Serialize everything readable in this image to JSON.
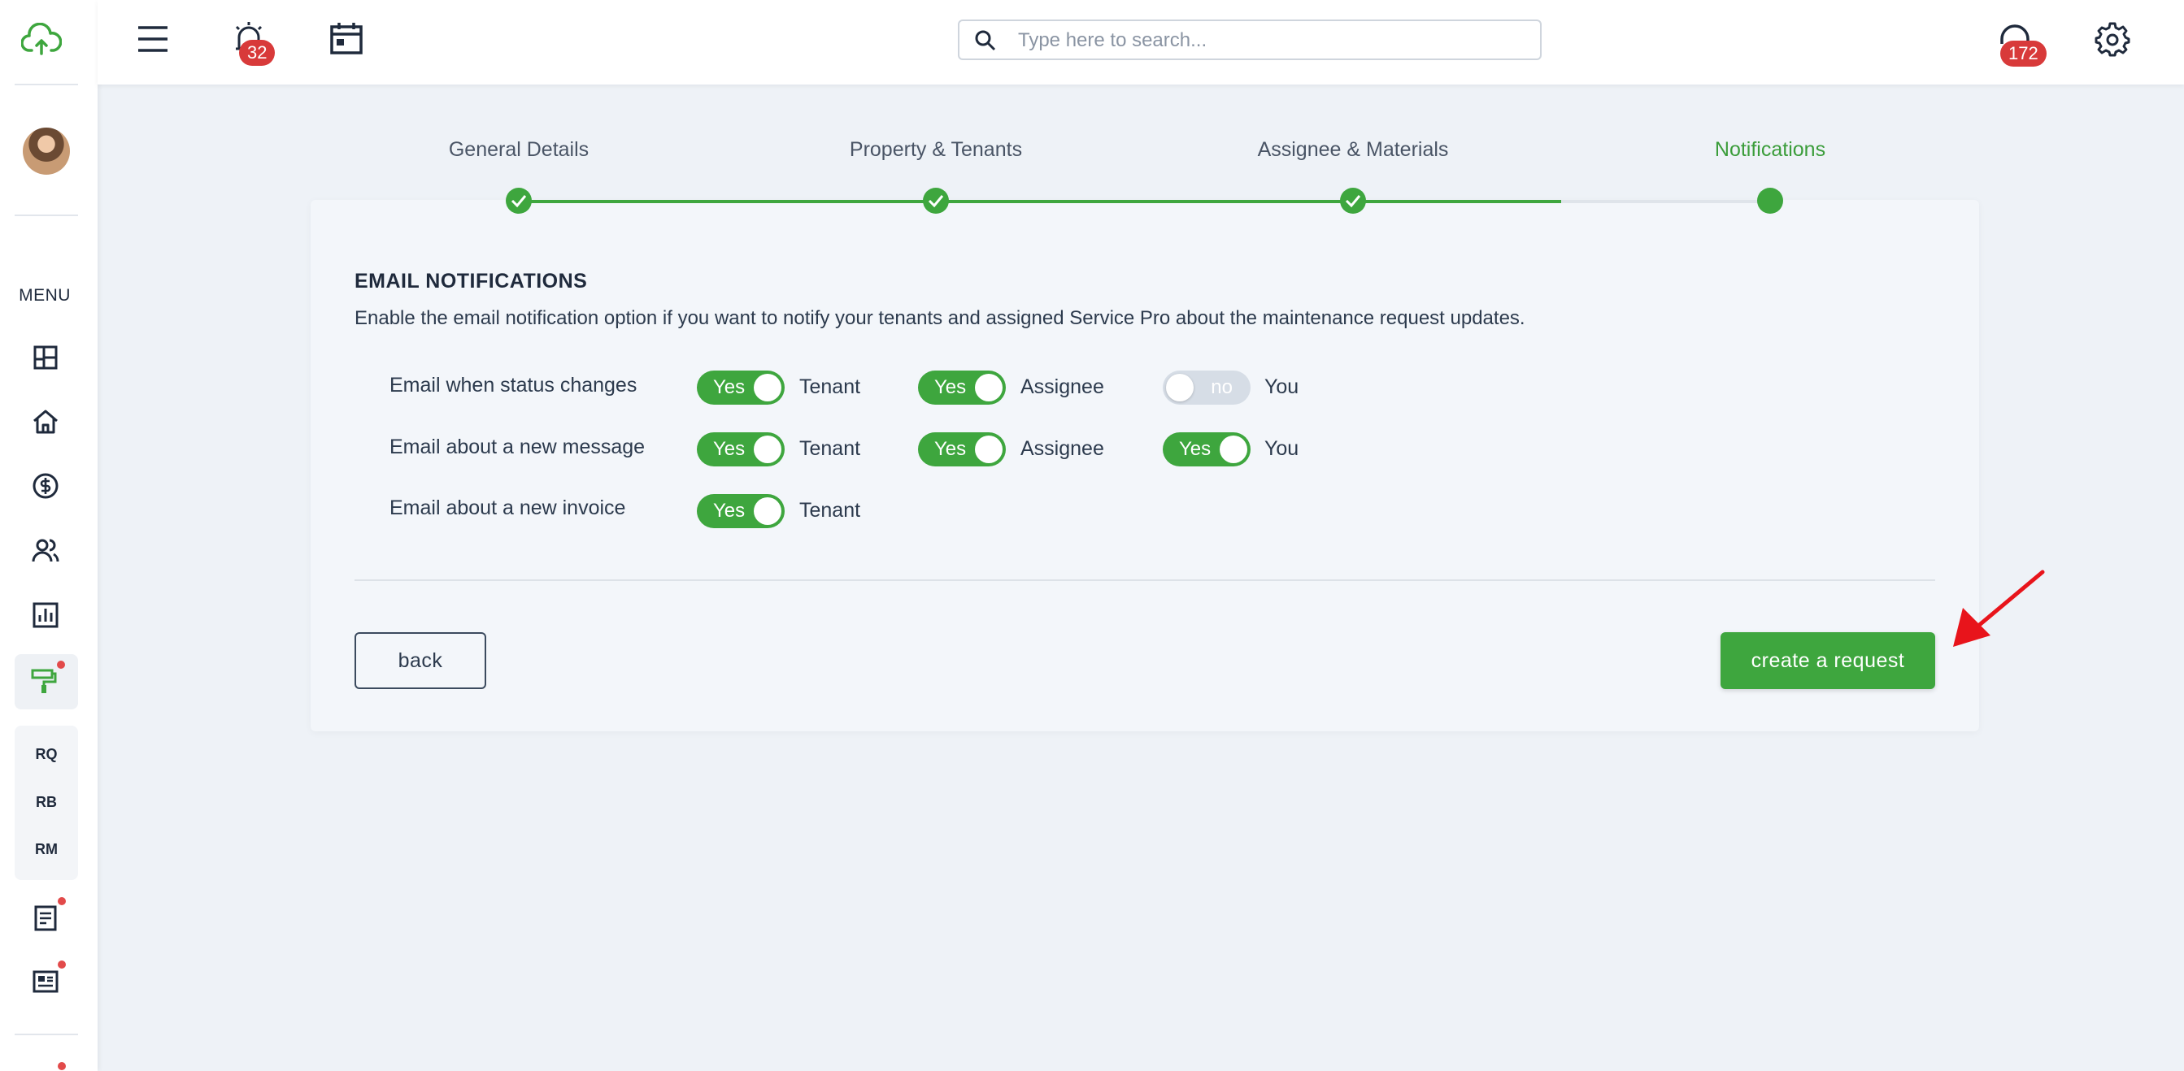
{
  "colors": {
    "accent": "#3ea63e",
    "badge": "#d83a3a",
    "annotation_arrow": "#e8141b"
  },
  "sidebar": {
    "menu_label": "MENU",
    "icons": [
      "cloud-upload-icon",
      "dashboard-icon",
      "home-icon",
      "dollar-icon",
      "users-icon",
      "chart-icon",
      "paint-roller-icon",
      "document-icon",
      "news-icon"
    ],
    "sub_items": [
      "RQ",
      "RB",
      "RM"
    ]
  },
  "topbar": {
    "alarm_count": "32",
    "search_placeholder": "Type here to search...",
    "support_count": "172"
  },
  "stepper": {
    "steps": [
      "General Details",
      "Property & Tenants",
      "Assignee & Materials",
      "Notifications"
    ],
    "active_step": "Notifications"
  },
  "email": {
    "title": "EMAIL NOTIFICATIONS",
    "description": "Enable the email notification option if you want to notify your tenants and assigned Service Pro about the maintenance request updates.",
    "rows": [
      {
        "label": "Email when status changes",
        "toggles": [
          {
            "state": "Yes",
            "target": "Tenant"
          },
          {
            "state": "Yes",
            "target": "Assignee"
          },
          {
            "state": "no",
            "target": "You"
          }
        ]
      },
      {
        "label": "Email about a new message",
        "toggles": [
          {
            "state": "Yes",
            "target": "Tenant"
          },
          {
            "state": "Yes",
            "target": "Assignee"
          },
          {
            "state": "Yes",
            "target": "You"
          }
        ]
      },
      {
        "label": "Email about a new invoice",
        "toggles": [
          {
            "state": "Yes",
            "target": "Tenant"
          }
        ]
      }
    ]
  },
  "actions": {
    "back": "back",
    "create": "create a request"
  }
}
